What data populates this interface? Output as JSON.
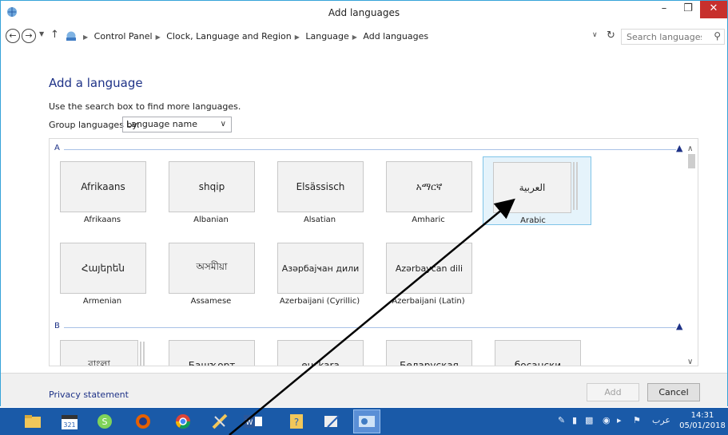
{
  "window": {
    "title": "Add languages",
    "minimize": "–",
    "maximize": "❐",
    "close": "✕"
  },
  "address": {
    "breadcrumbs": [
      "Control Panel",
      "Clock, Language and Region",
      "Language",
      "Add languages"
    ],
    "search_placeholder": "Search languages"
  },
  "main": {
    "heading": "Add a language",
    "hint": "Use the search box to find more languages.",
    "group_label": "Group languages by:",
    "group_value": "Language name"
  },
  "sections": [
    {
      "letter": "A"
    },
    {
      "letter": "B"
    }
  ],
  "languages_a": [
    {
      "native": "Afrikaans",
      "name": "Afrikaans"
    },
    {
      "native": "shqip",
      "name": "Albanian"
    },
    {
      "native": "Elsässisch",
      "name": "Alsatian"
    },
    {
      "native": "አማርኛ",
      "name": "Amharic"
    },
    {
      "native": "العربية",
      "name": "Arabic"
    },
    {
      "native": "Հայերեն",
      "name": "Armenian"
    },
    {
      "native": "অসমীয়া",
      "name": "Assamese"
    },
    {
      "native": "Азәрбајҹан дили",
      "name": "Azerbaijani (Cyrillic)"
    },
    {
      "native": "Azərbaycan dili",
      "name": "Azerbaijani (Latin)"
    }
  ],
  "languages_b": [
    {
      "native": "বাংলা"
    },
    {
      "native": "Башҡорт"
    },
    {
      "native": "euskara"
    },
    {
      "native": "Беларуская"
    },
    {
      "native": "босански"
    }
  ],
  "footer": {
    "privacy": "Privacy statement",
    "add": "Add",
    "cancel": "Cancel"
  },
  "taskbar": {
    "time": "14:31",
    "date": "05/01/2018",
    "input_language": "عرب"
  },
  "colors": {
    "accent": "#1e3287",
    "selection": "#e5f3fb",
    "taskbar": "#1a5aa8",
    "close": "#c7302d"
  }
}
